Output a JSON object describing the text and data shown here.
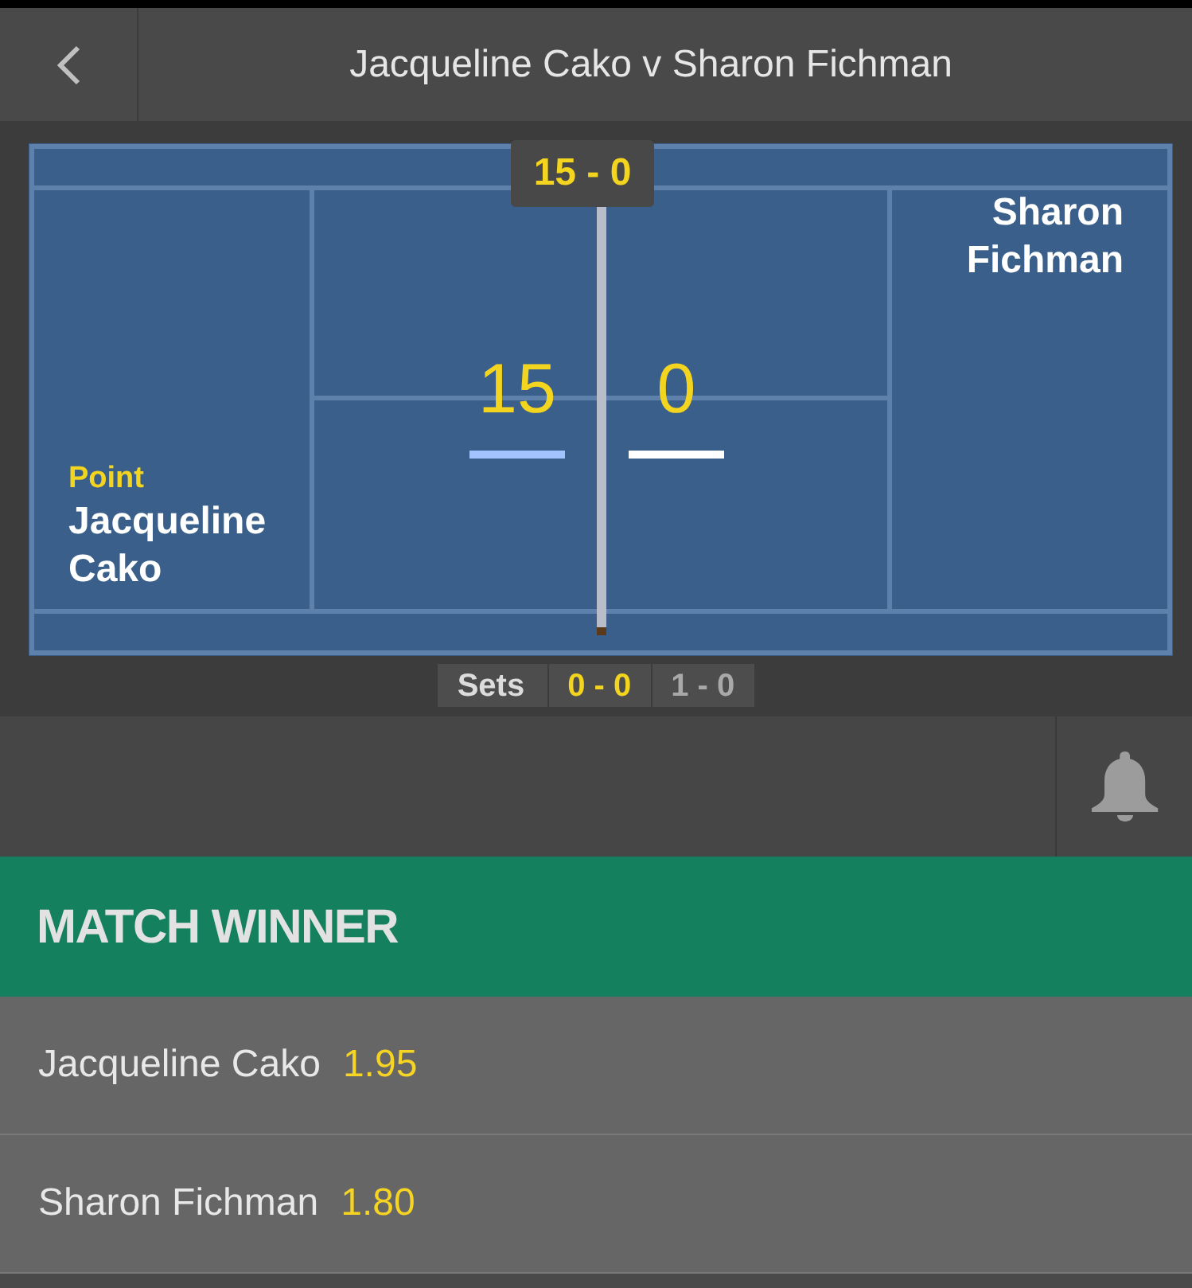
{
  "header": {
    "title": "Jacqueline Cako v Sharon Fichman"
  },
  "scoreboard": {
    "game_score": "15 - 0",
    "players": [
      {
        "name": "Jacqueline Cako",
        "label": "Point",
        "points": "15",
        "highlighted": true
      },
      {
        "name": "Sharon Fichman",
        "points": "0",
        "highlighted": false
      }
    ],
    "sets_label": "Sets",
    "sets": [
      {
        "score": "0 - 0",
        "selected": true
      },
      {
        "score": "1 - 0",
        "selected": false
      }
    ]
  },
  "market": {
    "title": "MATCH WINNER",
    "selections": [
      {
        "name": "Jacqueline Cako",
        "odds": "1.95"
      },
      {
        "name": "Sharon Fichman",
        "odds": "1.80"
      }
    ]
  }
}
